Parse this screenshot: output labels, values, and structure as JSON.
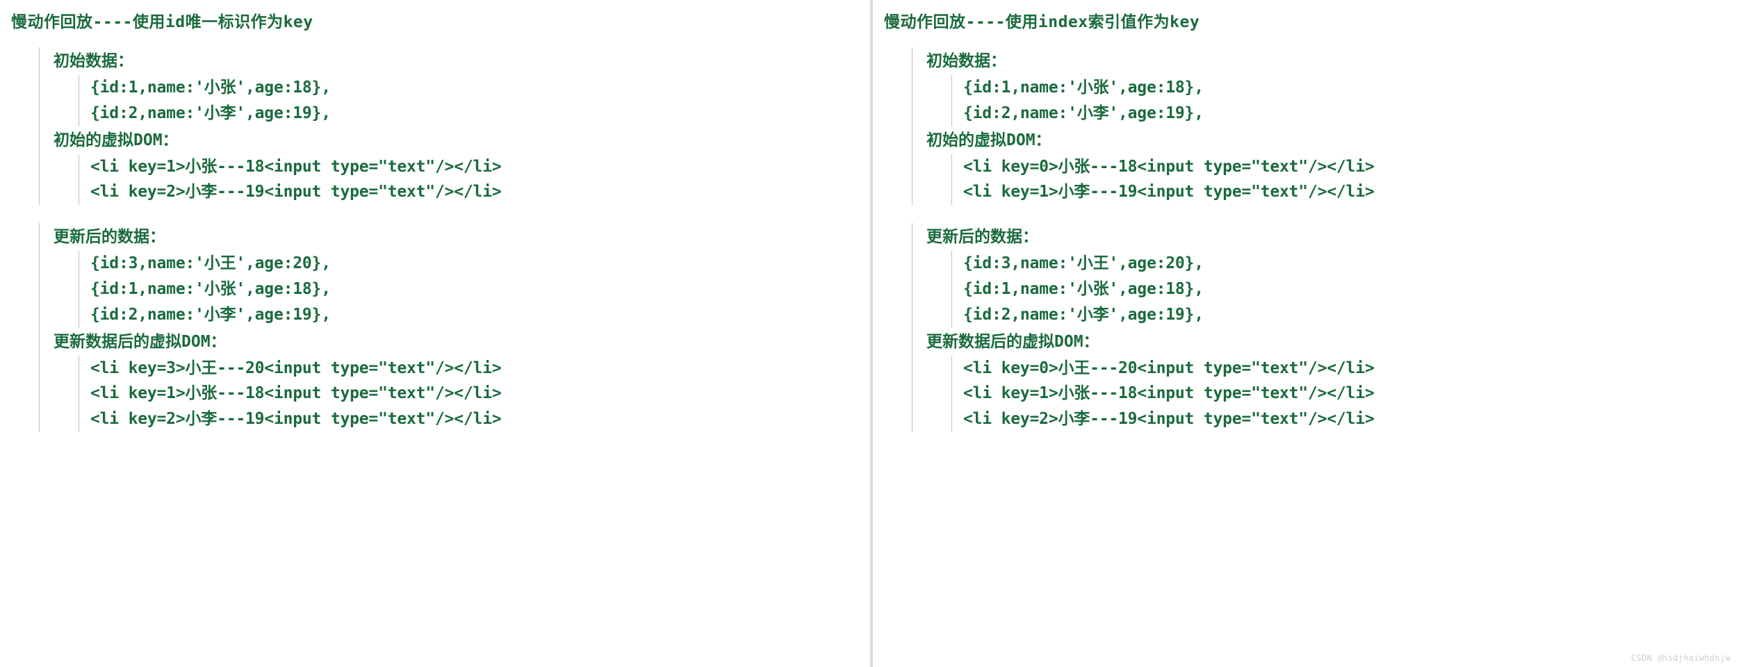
{
  "left": {
    "title": "慢动作回放----使用id唯一标识作为key",
    "section1": {
      "heading": "初始数据：",
      "items": [
        "{id:1,name:'小张',age:18},",
        "{id:2,name:'小李',age:19},"
      ]
    },
    "section2": {
      "heading": "初始的虚拟DOM：",
      "items": [
        "<li key=1>小张---18<input type=\"text\"/></li>",
        "<li key=2>小李---19<input type=\"text\"/></li>"
      ]
    },
    "section3": {
      "heading": "更新后的数据：",
      "items": [
        "{id:3,name:'小王',age:20},",
        "{id:1,name:'小张',age:18},",
        "{id:2,name:'小李',age:19},"
      ]
    },
    "section4": {
      "heading": "更新数据后的虚拟DOM：",
      "items": [
        "<li key=3>小王---20<input type=\"text\"/></li>",
        "<li key=1>小张---18<input type=\"text\"/></li>",
        "<li key=2>小李---19<input type=\"text\"/></li>"
      ]
    }
  },
  "right": {
    "title": "慢动作回放----使用index索引值作为key",
    "section1": {
      "heading": "初始数据：",
      "items": [
        "{id:1,name:'小张',age:18},",
        "{id:2,name:'小李',age:19},"
      ]
    },
    "section2": {
      "heading": "初始的虚拟DOM：",
      "items": [
        "<li key=0>小张---18<input type=\"text\"/></li>",
        "<li key=1>小李---19<input type=\"text\"/></li>"
      ]
    },
    "section3": {
      "heading": "更新后的数据：",
      "items": [
        "{id:3,name:'小王',age:20},",
        "{id:1,name:'小张',age:18},",
        "{id:2,name:'小李',age:19},"
      ]
    },
    "section4": {
      "heading": "更新数据后的虚拟DOM：",
      "items": [
        "<li key=0>小王---20<input type=\"text\"/></li>",
        "<li key=1>小张---18<input type=\"text\"/></li>",
        "<li key=2>小李---19<input type=\"text\"/></li>"
      ]
    }
  },
  "watermark": "CSDN @hsdjhaiwhdnjw"
}
